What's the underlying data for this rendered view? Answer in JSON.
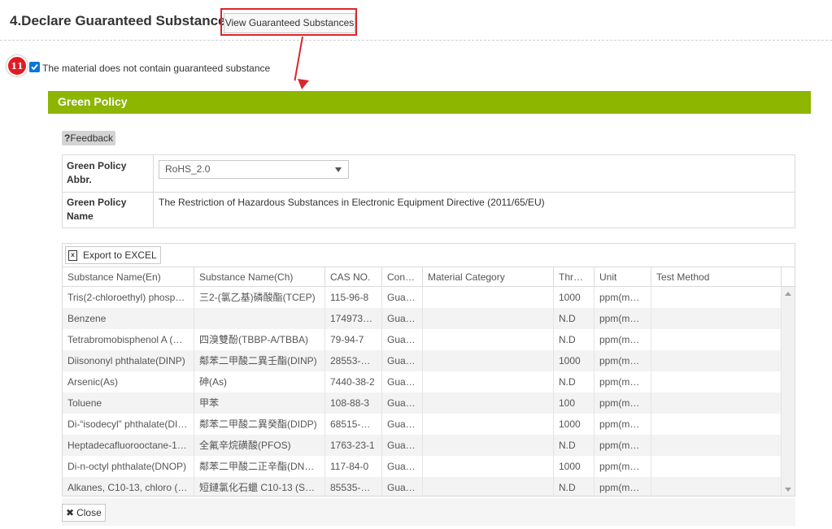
{
  "section": {
    "title": "4.Declare Guaranteed Substances",
    "view_button_label": "View Guaranteed Substances"
  },
  "step_badge": "11",
  "checkbox": {
    "checked": true,
    "label": "The material does not contain guaranteed substance"
  },
  "panel": {
    "title": "Green Policy",
    "feedback_label": "Feedback",
    "feedback_prefix": "?",
    "fields": {
      "abbr_label": "Green Policy Abbr.",
      "abbr_value": "RoHS_2.0",
      "name_label": "Green Policy Name",
      "name_value": "The Restriction of Hazardous Substances in Electronic Equipment Directive (2011/65/EU)"
    },
    "export_label": "Export to EXCEL",
    "close_label": "Close"
  },
  "grid": {
    "columns": [
      "Substance Name(En)",
      "Substance Name(Ch)",
      "CAS NO.",
      "Con…",
      "Material Category",
      "Thr…",
      "Unit",
      "Test Method"
    ],
    "rows": [
      [
        "Tris(2-chloroethyl) phosp…",
        "三2-(氯乙基)磷酸酯(TCEP)",
        "115-96-8",
        "Gua…",
        "",
        "1000",
        "ppm(m…",
        ""
      ],
      [
        "Benzene",
        "",
        "174973…",
        "Gua…",
        "",
        "N.D",
        "ppm(m…",
        ""
      ],
      [
        "Tetrabromobisphenol A (…",
        "四溴雙酚(TBBP-A/TBBA)",
        "79-94-7",
        "Gua…",
        "",
        "N.D",
        "ppm(m…",
        ""
      ],
      [
        "Diisononyl phthalate(DINP)",
        "鄰苯二甲酸二異壬酯(DINP)",
        "28553-…",
        "Gua…",
        "",
        "1000",
        "ppm(m…",
        ""
      ],
      [
        "Arsenic(As)",
        "砷(As)",
        "7440-38-2",
        "Gua…",
        "",
        "N.D",
        "ppm(m…",
        ""
      ],
      [
        "Toluene",
        "甲苯",
        "108-88-3",
        "Gua…",
        "",
        "100",
        "ppm(m…",
        ""
      ],
      [
        "Di-“isodecyl” phthalate(DI…",
        "鄰苯二甲酸二異癸酯(DIDP)",
        "68515-…",
        "Gua…",
        "",
        "1000",
        "ppm(m…",
        ""
      ],
      [
        "Heptadecafluorooctane-1…",
        "全氟辛烷磺酸(PFOS)",
        "1763-23-1",
        "Gua…",
        "",
        "N.D",
        "ppm(m…",
        ""
      ],
      [
        "Di-n-octyl phthalate(DNOP)",
        "鄰苯二甲酸二正辛酯(DN…",
        "117-84-0",
        "Gua…",
        "",
        "1000",
        "ppm(m…",
        ""
      ],
      [
        "Alkanes, C10-13, chloro (…",
        "短鏈氯化石蠟 C10-13 (S…",
        "85535-…",
        "Gua…",
        "",
        "N.D",
        "ppm(m…",
        ""
      ]
    ]
  },
  "colors": {
    "green_header": "#8db600",
    "highlight_red": "#d9262b",
    "badge_red": "#e11b22",
    "checkbox_blue": "#0b75d9"
  }
}
